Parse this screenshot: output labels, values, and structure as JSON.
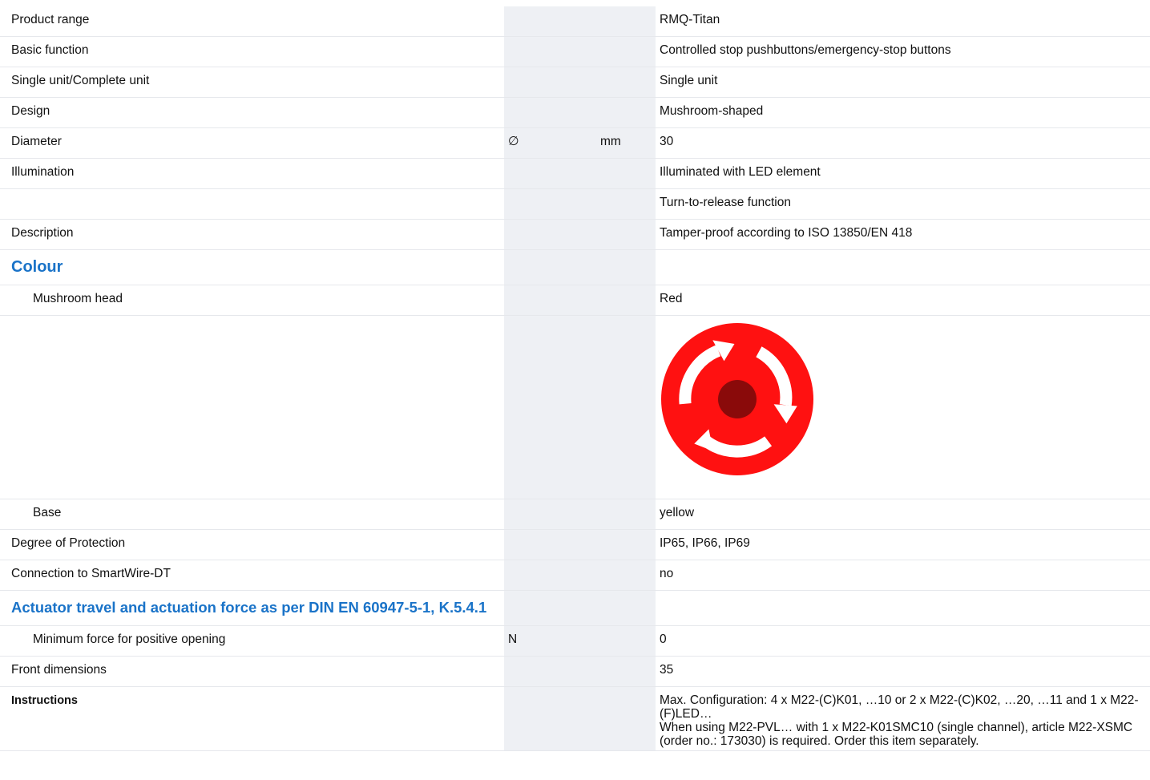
{
  "rows": [
    {
      "label": "Product range",
      "symbol": "",
      "unit": "",
      "value": "RMQ-Titan"
    },
    {
      "label": "Basic function",
      "symbol": "",
      "unit": "",
      "value": "Controlled stop pushbuttons/emergency-stop buttons"
    },
    {
      "label": "Single unit/Complete unit",
      "symbol": "",
      "unit": "",
      "value": "Single unit"
    },
    {
      "label": "Design",
      "symbol": "",
      "unit": "",
      "value": "Mushroom-shaped"
    },
    {
      "label": "Diameter",
      "symbol": "∅",
      "unit": "mm",
      "value": "30"
    },
    {
      "label": "Illumination",
      "symbol": "",
      "unit": "",
      "value": "Illuminated with LED element"
    },
    {
      "label": "",
      "symbol": "",
      "unit": "",
      "value": "Turn-to-release function"
    },
    {
      "label": "Description",
      "symbol": "",
      "unit": "",
      "value": "Tamper-proof according to ISO 13850/EN 418"
    }
  ],
  "colour_section": {
    "heading": "Colour",
    "mushroom_head": {
      "label": "Mushroom head",
      "value": "Red"
    },
    "base": {
      "label": "Base",
      "value": "yellow"
    }
  },
  "product_image": {
    "icon": "emergency-stop-button-icon",
    "head_color": "#ff1111",
    "center_color": "#8a0a0a",
    "arrow_color": "#ffffff"
  },
  "rows2": [
    {
      "label": "Degree of Protection",
      "value": "IP65, IP66, IP69"
    },
    {
      "label": "Connection to SmartWire-DT",
      "value": "no"
    }
  ],
  "actuator_section": {
    "heading": "Actuator travel and actuation force as per DIN EN 60947-5-1, K.5.4.1",
    "min_force": {
      "label": "Minimum force for positive opening",
      "symbol": "N",
      "value": "0"
    }
  },
  "front_dimensions": {
    "label": "Front dimensions",
    "value": "35"
  },
  "instructions": {
    "label": "Instructions",
    "line1": "Max. Configuration: 4 x M22-(C)K01, …10 or 2 x M22-(C)K02, …20, …11 and 1 x M22-(F)LED…",
    "line2": "When using M22-PVL… with 1 x M22-K01SMC10 (single channel), article M22-XSMC (order no.: 173030) is required. Order this item separately."
  },
  "colors": {
    "heading_blue": "#1a73c8",
    "shaded_column": "#eef0f4",
    "row_rule": "#e6e8ec"
  }
}
